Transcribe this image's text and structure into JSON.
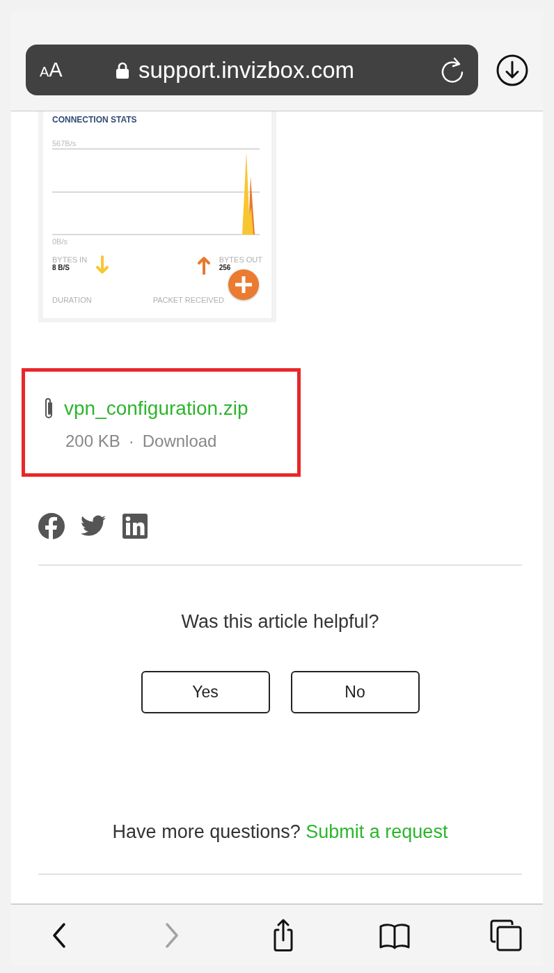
{
  "address_bar": {
    "text_size_label": "AA",
    "url": "support.invizbox.com",
    "secure": true
  },
  "article_image": {
    "title": "CONNECTION STATS",
    "y_max_label": "567B/s",
    "y_min_label": "0B/s",
    "stats": [
      {
        "label": "BYTES IN",
        "value": "8 B/S",
        "kind": "down",
        "color": "#f8c630"
      },
      {
        "label": "BYTES OUT",
        "value": "256",
        "kind": "up",
        "color": "#e8792f"
      }
    ],
    "footer_labels": [
      "DURATION",
      "PACKET RECEIVED"
    ]
  },
  "attachment": {
    "name": "vpn_configuration.zip",
    "size": "200 KB",
    "separator": "·",
    "action": "Download",
    "highlighted": true
  },
  "share_links": [
    {
      "kind": "facebook"
    },
    {
      "kind": "twitter"
    },
    {
      "kind": "linkedin"
    }
  ],
  "feedback": {
    "question": "Was this article helpful?",
    "buttons": [
      "Yes",
      "No"
    ]
  },
  "more_questions": {
    "text": "Have more questions?",
    "link": "Submit a request"
  },
  "toolbar": [
    {
      "kind": "back",
      "disabled": false
    },
    {
      "kind": "forward",
      "disabled": true
    },
    {
      "kind": "share",
      "disabled": false
    },
    {
      "kind": "bookmarks",
      "disabled": false
    },
    {
      "kind": "tabs",
      "disabled": false
    }
  ]
}
